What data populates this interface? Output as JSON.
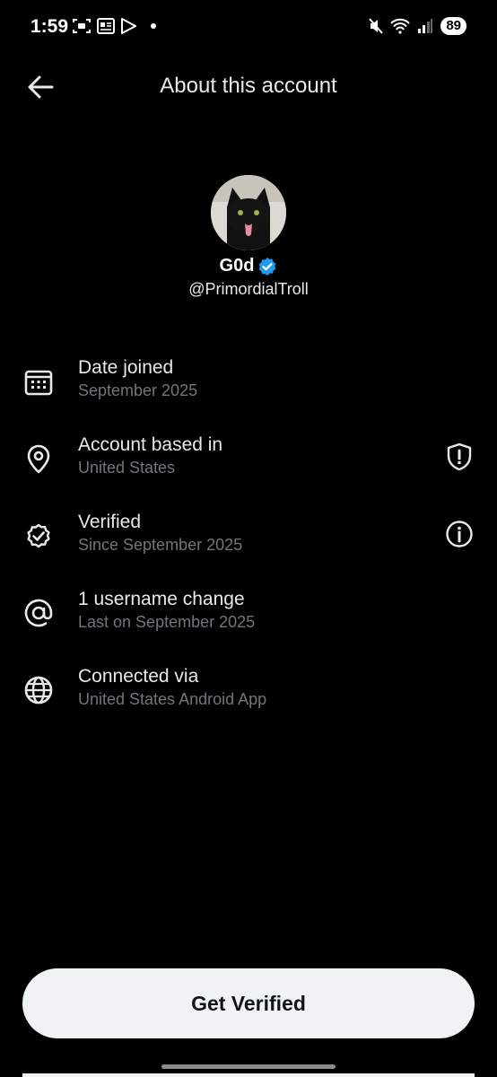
{
  "status_bar": {
    "time": "1:59",
    "battery": "89",
    "icons": [
      "screenshot-icon",
      "news-icon",
      "play-store-icon",
      "notification-dot",
      "mute-icon",
      "wifi-icon",
      "signal-icon",
      "battery-icon"
    ]
  },
  "header": {
    "title": "About this account",
    "back_icon": "back-arrow-icon"
  },
  "profile": {
    "display_name": "G0d",
    "handle": "@PrimordialTroll",
    "verified_badge": "verified-badge-icon"
  },
  "info_rows": [
    {
      "icon": "calendar-icon",
      "title": "Date joined",
      "subtitle": "September 2025",
      "action_icon": null
    },
    {
      "icon": "location-pin-icon",
      "title": "Account based in",
      "subtitle": "United States",
      "action_icon": "shield-alert-icon"
    },
    {
      "icon": "verified-outline-icon",
      "title": "Verified",
      "subtitle": "Since September 2025",
      "action_icon": "info-icon"
    },
    {
      "icon": "at-icon",
      "title": "1 username change",
      "subtitle": "Last on September 2025",
      "action_icon": null
    },
    {
      "icon": "globe-icon",
      "title": "Connected via",
      "subtitle": "United States Android App",
      "action_icon": null
    }
  ],
  "cta": {
    "label": "Get Verified"
  },
  "colors": {
    "background": "#000000",
    "text_primary": "#e7e9ea",
    "text_secondary": "#71767b",
    "verified_blue": "#1d9bf0",
    "button_bg": "#eff3f4",
    "button_text": "#0f1419"
  }
}
